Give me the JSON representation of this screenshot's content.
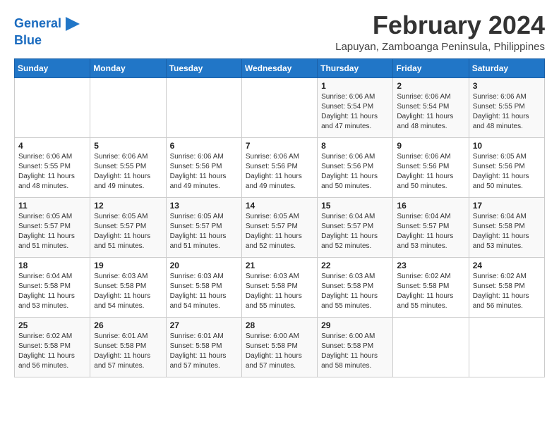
{
  "header": {
    "logo_line1": "General",
    "logo_line2": "Blue",
    "month": "February 2024",
    "location": "Lapuyan, Zamboanga Peninsula, Philippines"
  },
  "weekdays": [
    "Sunday",
    "Monday",
    "Tuesday",
    "Wednesday",
    "Thursday",
    "Friday",
    "Saturday"
  ],
  "weeks": [
    [
      {
        "day": "",
        "info": ""
      },
      {
        "day": "",
        "info": ""
      },
      {
        "day": "",
        "info": ""
      },
      {
        "day": "",
        "info": ""
      },
      {
        "day": "1",
        "info": "Sunrise: 6:06 AM\nSunset: 5:54 PM\nDaylight: 11 hours\nand 47 minutes."
      },
      {
        "day": "2",
        "info": "Sunrise: 6:06 AM\nSunset: 5:54 PM\nDaylight: 11 hours\nand 48 minutes."
      },
      {
        "day": "3",
        "info": "Sunrise: 6:06 AM\nSunset: 5:55 PM\nDaylight: 11 hours\nand 48 minutes."
      }
    ],
    [
      {
        "day": "4",
        "info": "Sunrise: 6:06 AM\nSunset: 5:55 PM\nDaylight: 11 hours\nand 48 minutes."
      },
      {
        "day": "5",
        "info": "Sunrise: 6:06 AM\nSunset: 5:55 PM\nDaylight: 11 hours\nand 49 minutes."
      },
      {
        "day": "6",
        "info": "Sunrise: 6:06 AM\nSunset: 5:56 PM\nDaylight: 11 hours\nand 49 minutes."
      },
      {
        "day": "7",
        "info": "Sunrise: 6:06 AM\nSunset: 5:56 PM\nDaylight: 11 hours\nand 49 minutes."
      },
      {
        "day": "8",
        "info": "Sunrise: 6:06 AM\nSunset: 5:56 PM\nDaylight: 11 hours\nand 50 minutes."
      },
      {
        "day": "9",
        "info": "Sunrise: 6:06 AM\nSunset: 5:56 PM\nDaylight: 11 hours\nand 50 minutes."
      },
      {
        "day": "10",
        "info": "Sunrise: 6:05 AM\nSunset: 5:56 PM\nDaylight: 11 hours\nand 50 minutes."
      }
    ],
    [
      {
        "day": "11",
        "info": "Sunrise: 6:05 AM\nSunset: 5:57 PM\nDaylight: 11 hours\nand 51 minutes."
      },
      {
        "day": "12",
        "info": "Sunrise: 6:05 AM\nSunset: 5:57 PM\nDaylight: 11 hours\nand 51 minutes."
      },
      {
        "day": "13",
        "info": "Sunrise: 6:05 AM\nSunset: 5:57 PM\nDaylight: 11 hours\nand 51 minutes."
      },
      {
        "day": "14",
        "info": "Sunrise: 6:05 AM\nSunset: 5:57 PM\nDaylight: 11 hours\nand 52 minutes."
      },
      {
        "day": "15",
        "info": "Sunrise: 6:04 AM\nSunset: 5:57 PM\nDaylight: 11 hours\nand 52 minutes."
      },
      {
        "day": "16",
        "info": "Sunrise: 6:04 AM\nSunset: 5:57 PM\nDaylight: 11 hours\nand 53 minutes."
      },
      {
        "day": "17",
        "info": "Sunrise: 6:04 AM\nSunset: 5:58 PM\nDaylight: 11 hours\nand 53 minutes."
      }
    ],
    [
      {
        "day": "18",
        "info": "Sunrise: 6:04 AM\nSunset: 5:58 PM\nDaylight: 11 hours\nand 53 minutes."
      },
      {
        "day": "19",
        "info": "Sunrise: 6:03 AM\nSunset: 5:58 PM\nDaylight: 11 hours\nand 54 minutes."
      },
      {
        "day": "20",
        "info": "Sunrise: 6:03 AM\nSunset: 5:58 PM\nDaylight: 11 hours\nand 54 minutes."
      },
      {
        "day": "21",
        "info": "Sunrise: 6:03 AM\nSunset: 5:58 PM\nDaylight: 11 hours\nand 55 minutes."
      },
      {
        "day": "22",
        "info": "Sunrise: 6:03 AM\nSunset: 5:58 PM\nDaylight: 11 hours\nand 55 minutes."
      },
      {
        "day": "23",
        "info": "Sunrise: 6:02 AM\nSunset: 5:58 PM\nDaylight: 11 hours\nand 55 minutes."
      },
      {
        "day": "24",
        "info": "Sunrise: 6:02 AM\nSunset: 5:58 PM\nDaylight: 11 hours\nand 56 minutes."
      }
    ],
    [
      {
        "day": "25",
        "info": "Sunrise: 6:02 AM\nSunset: 5:58 PM\nDaylight: 11 hours\nand 56 minutes."
      },
      {
        "day": "26",
        "info": "Sunrise: 6:01 AM\nSunset: 5:58 PM\nDaylight: 11 hours\nand 57 minutes."
      },
      {
        "day": "27",
        "info": "Sunrise: 6:01 AM\nSunset: 5:58 PM\nDaylight: 11 hours\nand 57 minutes."
      },
      {
        "day": "28",
        "info": "Sunrise: 6:00 AM\nSunset: 5:58 PM\nDaylight: 11 hours\nand 57 minutes."
      },
      {
        "day": "29",
        "info": "Sunrise: 6:00 AM\nSunset: 5:58 PM\nDaylight: 11 hours\nand 58 minutes."
      },
      {
        "day": "",
        "info": ""
      },
      {
        "day": "",
        "info": ""
      }
    ]
  ]
}
